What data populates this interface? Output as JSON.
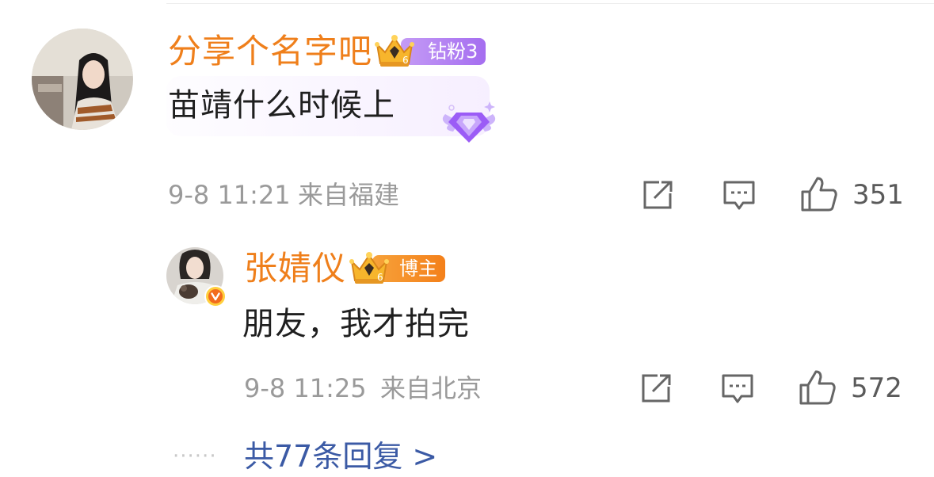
{
  "comment": {
    "username": "分享个名字吧",
    "fan_badge": "钻粉3",
    "text": "苗靖什么时候上",
    "time": "9-8 11:21",
    "location": "来自福建",
    "like_count": "351"
  },
  "reply": {
    "username": "张婧仪",
    "role_badge": "博主",
    "text": "朋友，我才拍完",
    "time": "9-8 11:25",
    "location": "来自北京",
    "like_count": "572"
  },
  "more_replies": {
    "dots": "······",
    "label": "共77条回复 >"
  },
  "colors": {
    "username": "#ef7f1b",
    "fan_badge": "#b07cf0",
    "role_badge": "#f5871f",
    "link": "#3b5aa5",
    "verified": "#f26b1d"
  },
  "icons": [
    "share-icon",
    "comment-icon",
    "like-icon",
    "diamond-wings-icon",
    "crown-icon",
    "verified-icon"
  ]
}
